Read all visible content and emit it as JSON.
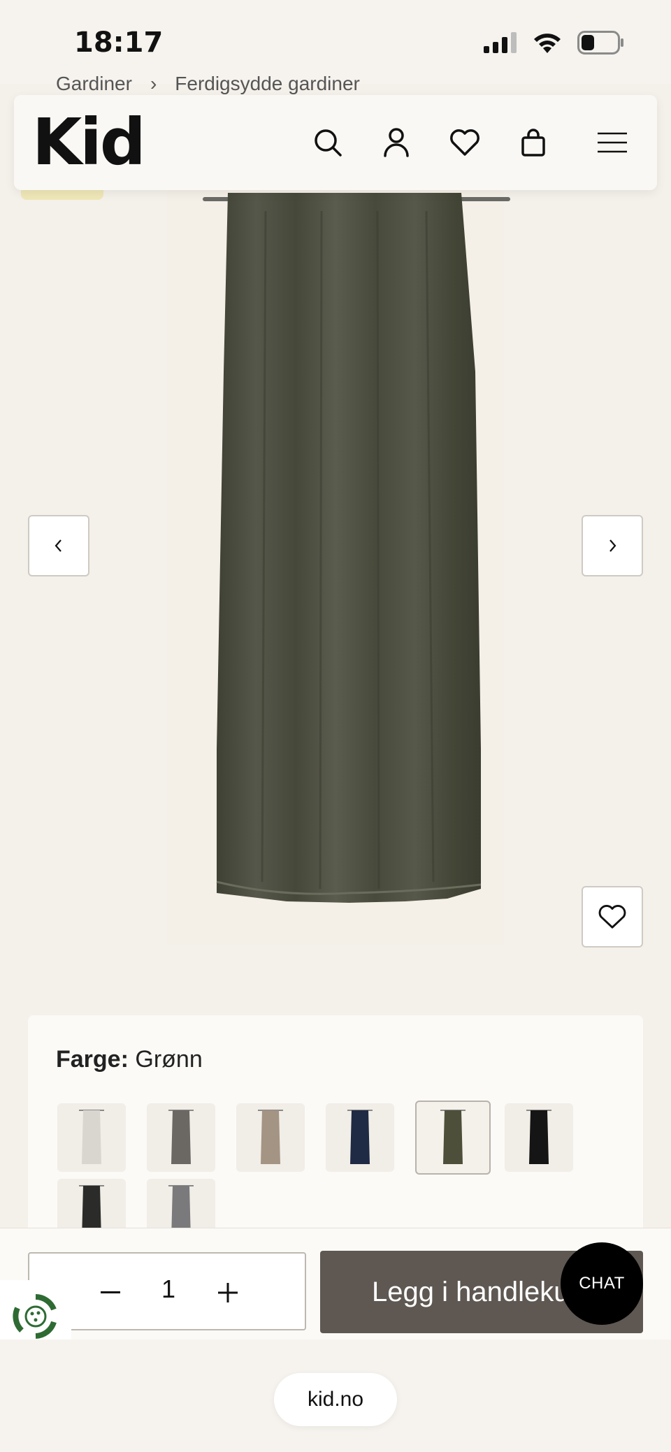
{
  "status": {
    "time": "18:17"
  },
  "breadcrumb": {
    "items": [
      "Gardiner",
      "Ferdigsydde gardiner"
    ]
  },
  "header": {
    "logo": "Kid",
    "icons": [
      "search-icon",
      "account-icon",
      "wishlist-icon",
      "cart-icon",
      "menu-icon"
    ]
  },
  "product": {
    "image_color": "#4a4a3c",
    "color_label": "Farge:",
    "color_value": "Grønn",
    "swatches": [
      {
        "color": "#d9d6d0",
        "selected": false
      },
      {
        "color": "#6b6864",
        "selected": false
      },
      {
        "color": "#a49484",
        "selected": false
      },
      {
        "color": "#1f2a44",
        "selected": false
      },
      {
        "color": "#4d4f3a",
        "selected": true
      },
      {
        "color": "#151515",
        "selected": false
      },
      {
        "color": "#2b2c2a",
        "selected": false
      },
      {
        "color": "#7a7a7c",
        "selected": false
      }
    ]
  },
  "buy": {
    "quantity": "1",
    "add_label": "Legg i handlekurv"
  },
  "chat": {
    "label": "CHAT"
  },
  "browser": {
    "url": "kid.no"
  },
  "colors": {
    "accent": "#5f5852",
    "background": "#f4f0ea",
    "sale_badge": "#efe7b7"
  }
}
